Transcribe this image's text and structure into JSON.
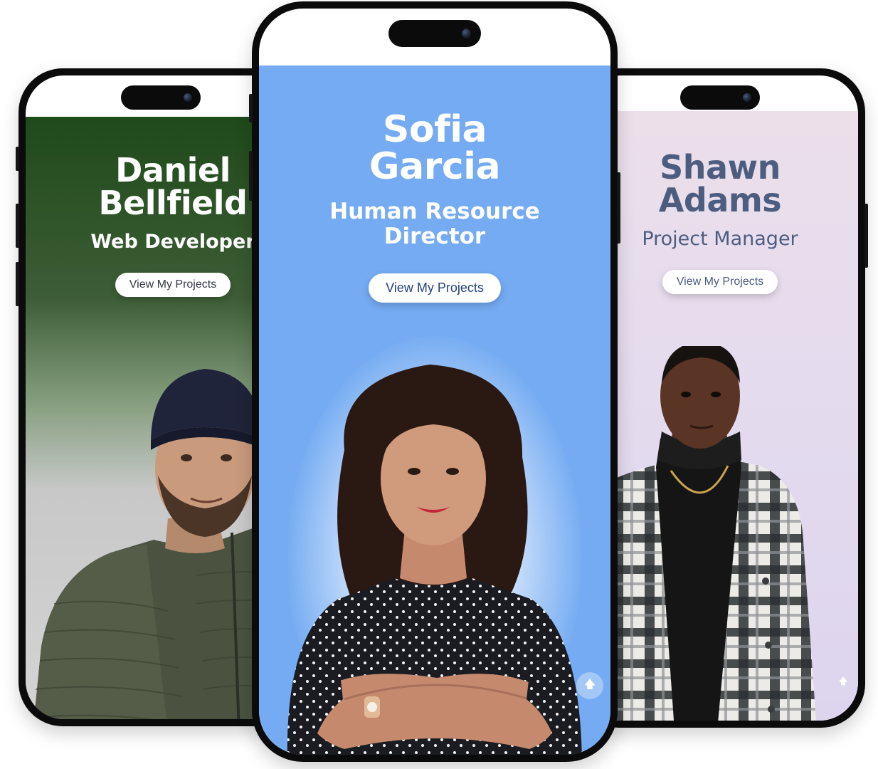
{
  "colors": {
    "phone_frame": "#0b0b0c",
    "left_top": "#1f4a1a",
    "center_bg": "#74abf2",
    "right_bg": "#e4dbee",
    "right_text": "#4d5d80",
    "center_cta_text": "#23437a"
  },
  "phones": {
    "left": {
      "name_first": "Daniel",
      "name_last": "Bellfield",
      "role": "Web Developer",
      "cta_label": "View My Projects"
    },
    "center": {
      "name_first": "Sofia",
      "name_last": "Garcia",
      "role_line1": "Human Resource",
      "role_line2": "Director",
      "cta_label": "View My Projects",
      "scroll_top_icon": "arrow-up-icon"
    },
    "right": {
      "name_first": "Shawn",
      "name_last": "Adams",
      "role": "Project Manager",
      "cta_label": "View My Projects",
      "scroll_top_icon": "arrow-up-icon"
    }
  }
}
